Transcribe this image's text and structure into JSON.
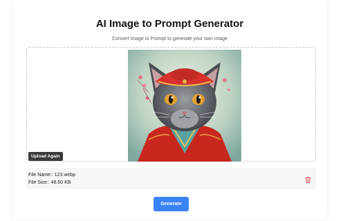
{
  "header": {
    "title": "AI Image to Prompt Generator",
    "subtitle": "Convert Image to Prompt to generate your own image"
  },
  "upload": {
    "preview_icon": "cat-in-red-robe-image",
    "upload_again_label": "Upload Again"
  },
  "file": {
    "name_line": "File Name:: 123.webp",
    "size_line": "File Size:: 48.60 KB",
    "delete_icon": "trash-icon"
  },
  "actions": {
    "generate_label": "Generate"
  },
  "colors": {
    "accent": "#3b82f6",
    "delete": "#e5484d"
  }
}
